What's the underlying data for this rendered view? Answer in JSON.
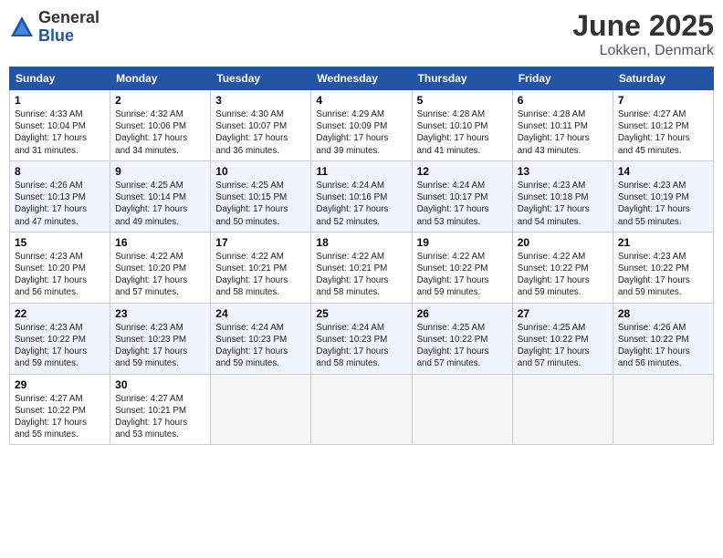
{
  "logo": {
    "general": "General",
    "blue": "Blue"
  },
  "title": {
    "month": "June 2025",
    "location": "Lokken, Denmark"
  },
  "headers": [
    "Sunday",
    "Monday",
    "Tuesday",
    "Wednesday",
    "Thursday",
    "Friday",
    "Saturday"
  ],
  "weeks": [
    [
      {
        "day": "1",
        "info": "Sunrise: 4:33 AM\nSunset: 10:04 PM\nDaylight: 17 hours\nand 31 minutes."
      },
      {
        "day": "2",
        "info": "Sunrise: 4:32 AM\nSunset: 10:06 PM\nDaylight: 17 hours\nand 34 minutes."
      },
      {
        "day": "3",
        "info": "Sunrise: 4:30 AM\nSunset: 10:07 PM\nDaylight: 17 hours\nand 36 minutes."
      },
      {
        "day": "4",
        "info": "Sunrise: 4:29 AM\nSunset: 10:09 PM\nDaylight: 17 hours\nand 39 minutes."
      },
      {
        "day": "5",
        "info": "Sunrise: 4:28 AM\nSunset: 10:10 PM\nDaylight: 17 hours\nand 41 minutes."
      },
      {
        "day": "6",
        "info": "Sunrise: 4:28 AM\nSunset: 10:11 PM\nDaylight: 17 hours\nand 43 minutes."
      },
      {
        "day": "7",
        "info": "Sunrise: 4:27 AM\nSunset: 10:12 PM\nDaylight: 17 hours\nand 45 minutes."
      }
    ],
    [
      {
        "day": "8",
        "info": "Sunrise: 4:26 AM\nSunset: 10:13 PM\nDaylight: 17 hours\nand 47 minutes."
      },
      {
        "day": "9",
        "info": "Sunrise: 4:25 AM\nSunset: 10:14 PM\nDaylight: 17 hours\nand 49 minutes."
      },
      {
        "day": "10",
        "info": "Sunrise: 4:25 AM\nSunset: 10:15 PM\nDaylight: 17 hours\nand 50 minutes."
      },
      {
        "day": "11",
        "info": "Sunrise: 4:24 AM\nSunset: 10:16 PM\nDaylight: 17 hours\nand 52 minutes."
      },
      {
        "day": "12",
        "info": "Sunrise: 4:24 AM\nSunset: 10:17 PM\nDaylight: 17 hours\nand 53 minutes."
      },
      {
        "day": "13",
        "info": "Sunrise: 4:23 AM\nSunset: 10:18 PM\nDaylight: 17 hours\nand 54 minutes."
      },
      {
        "day": "14",
        "info": "Sunrise: 4:23 AM\nSunset: 10:19 PM\nDaylight: 17 hours\nand 55 minutes."
      }
    ],
    [
      {
        "day": "15",
        "info": "Sunrise: 4:23 AM\nSunset: 10:20 PM\nDaylight: 17 hours\nand 56 minutes."
      },
      {
        "day": "16",
        "info": "Sunrise: 4:22 AM\nSunset: 10:20 PM\nDaylight: 17 hours\nand 57 minutes."
      },
      {
        "day": "17",
        "info": "Sunrise: 4:22 AM\nSunset: 10:21 PM\nDaylight: 17 hours\nand 58 minutes."
      },
      {
        "day": "18",
        "info": "Sunrise: 4:22 AM\nSunset: 10:21 PM\nDaylight: 17 hours\nand 58 minutes."
      },
      {
        "day": "19",
        "info": "Sunrise: 4:22 AM\nSunset: 10:22 PM\nDaylight: 17 hours\nand 59 minutes."
      },
      {
        "day": "20",
        "info": "Sunrise: 4:22 AM\nSunset: 10:22 PM\nDaylight: 17 hours\nand 59 minutes."
      },
      {
        "day": "21",
        "info": "Sunrise: 4:23 AM\nSunset: 10:22 PM\nDaylight: 17 hours\nand 59 minutes."
      }
    ],
    [
      {
        "day": "22",
        "info": "Sunrise: 4:23 AM\nSunset: 10:22 PM\nDaylight: 17 hours\nand 59 minutes."
      },
      {
        "day": "23",
        "info": "Sunrise: 4:23 AM\nSunset: 10:23 PM\nDaylight: 17 hours\nand 59 minutes."
      },
      {
        "day": "24",
        "info": "Sunrise: 4:24 AM\nSunset: 10:23 PM\nDaylight: 17 hours\nand 59 minutes."
      },
      {
        "day": "25",
        "info": "Sunrise: 4:24 AM\nSunset: 10:23 PM\nDaylight: 17 hours\nand 58 minutes."
      },
      {
        "day": "26",
        "info": "Sunrise: 4:25 AM\nSunset: 10:22 PM\nDaylight: 17 hours\nand 57 minutes."
      },
      {
        "day": "27",
        "info": "Sunrise: 4:25 AM\nSunset: 10:22 PM\nDaylight: 17 hours\nand 57 minutes."
      },
      {
        "day": "28",
        "info": "Sunrise: 4:26 AM\nSunset: 10:22 PM\nDaylight: 17 hours\nand 56 minutes."
      }
    ],
    [
      {
        "day": "29",
        "info": "Sunrise: 4:27 AM\nSunset: 10:22 PM\nDaylight: 17 hours\nand 55 minutes."
      },
      {
        "day": "30",
        "info": "Sunrise: 4:27 AM\nSunset: 10:21 PM\nDaylight: 17 hours\nand 53 minutes."
      },
      {
        "day": "",
        "info": ""
      },
      {
        "day": "",
        "info": ""
      },
      {
        "day": "",
        "info": ""
      },
      {
        "day": "",
        "info": ""
      },
      {
        "day": "",
        "info": ""
      }
    ]
  ]
}
